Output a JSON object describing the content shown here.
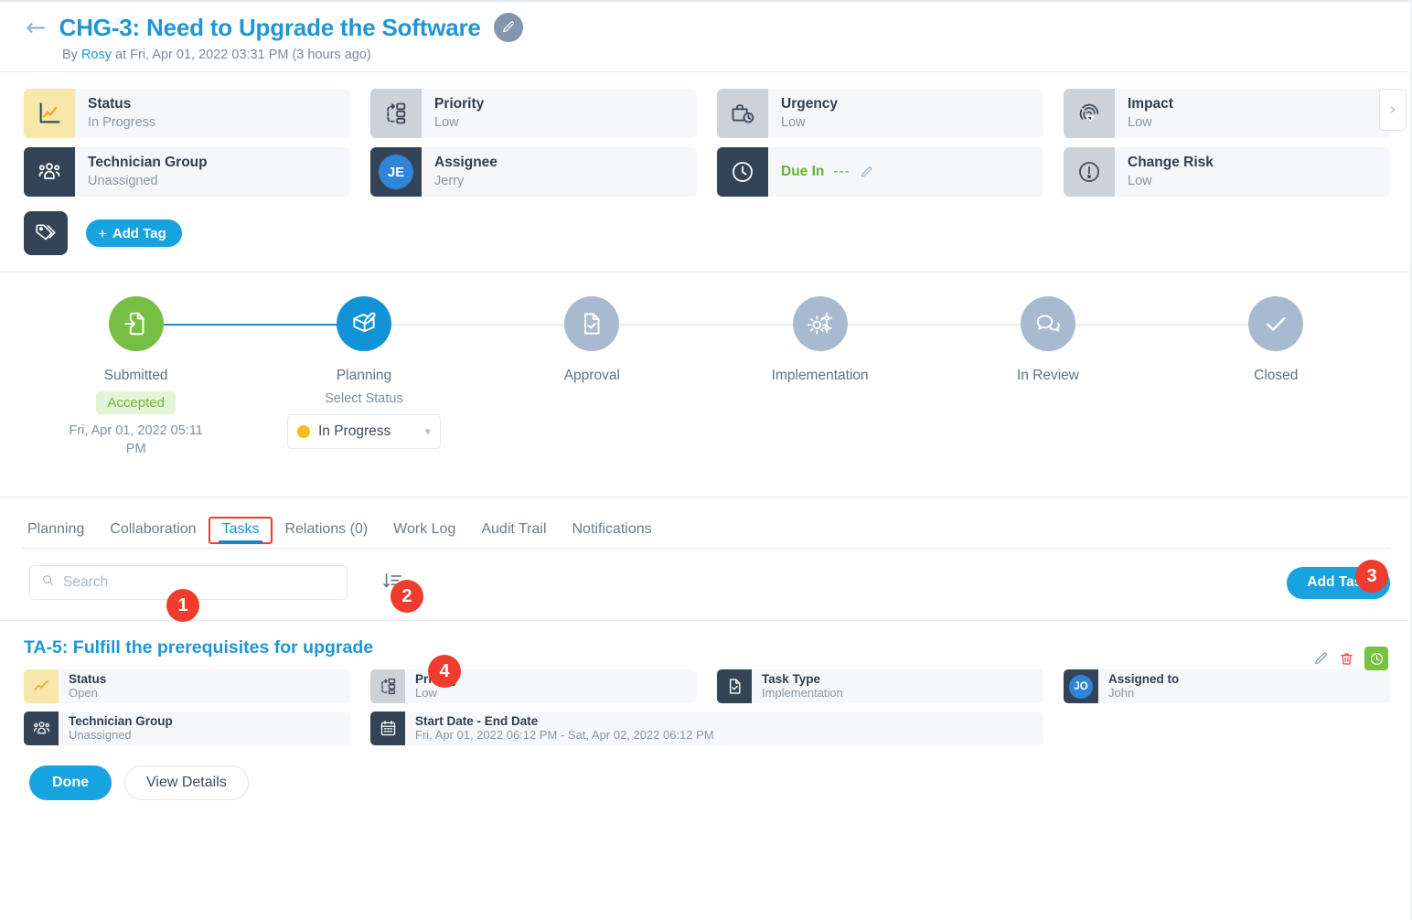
{
  "header": {
    "back_icon": "arrow-left-icon",
    "title": "CHG-3: Need to Upgrade the Software",
    "edit_icon": "pencil-icon",
    "byline_prefix": "By ",
    "byline_author": "Rosy",
    "byline_suffix": " at Fri, Apr 01, 2022 03:31 PM (3 hours ago)"
  },
  "properties": [
    {
      "label": "Status",
      "value": "In Progress",
      "icon": "chart-line-icon",
      "icon_style": "yellow"
    },
    {
      "label": "Priority",
      "value": "Low",
      "icon": "priority-icon",
      "icon_style": "gray"
    },
    {
      "label": "Urgency",
      "value": "Low",
      "icon": "briefcase-clock-icon",
      "icon_style": "gray"
    },
    {
      "label": "Impact",
      "value": "Low",
      "icon": "fingerprint-icon",
      "icon_style": "gray"
    },
    {
      "label": "Technician Group",
      "value": "Unassigned",
      "icon": "people-group-icon",
      "icon_style": "dark"
    },
    {
      "label": "Assignee",
      "value": "Jerry",
      "icon": "avatar",
      "icon_style": "dark",
      "initials": "JE"
    },
    {
      "label": "Due In",
      "value": "---",
      "icon": "clock-icon",
      "icon_style": "dark",
      "kind": "duein",
      "edit_icon": "pencil-icon"
    },
    {
      "label": "Change Risk",
      "value": "Low",
      "icon": "alert-circle-icon",
      "icon_style": "gray"
    }
  ],
  "scroll_next_icon": "chevron-right-icon",
  "tags": {
    "icon": "tag-icon",
    "add_label": "Add Tag",
    "plus": "+"
  },
  "workflow": [
    {
      "name": "Submitted",
      "icon": "file-import-icon",
      "state": "green",
      "badge": "Accepted",
      "date": "Fri, Apr 01, 2022 05:11 PM",
      "line": "done"
    },
    {
      "name": "Planning",
      "icon": "edit-board-icon",
      "state": "blue",
      "sub_label": "Select Status",
      "select_value": "In Progress",
      "select_dot_color": "#f7bd1a",
      "line": "todo"
    },
    {
      "name": "Approval",
      "icon": "file-check-icon",
      "state": "gray",
      "line": "todo"
    },
    {
      "name": "Implementation",
      "icon": "gears-icon",
      "state": "gray",
      "line": "todo"
    },
    {
      "name": "In Review",
      "icon": "chat-bubbles-icon",
      "state": "gray",
      "line": "todo"
    },
    {
      "name": "Closed",
      "icon": "check-icon",
      "state": "gray",
      "line": "none"
    }
  ],
  "tabs": [
    {
      "label": "Planning",
      "active": false
    },
    {
      "label": "Collaboration",
      "active": false
    },
    {
      "label": "Tasks",
      "active": true
    },
    {
      "label": "Relations (0)",
      "active": false
    },
    {
      "label": "Work Log",
      "active": false
    },
    {
      "label": "Audit Trail",
      "active": false
    },
    {
      "label": "Notifications",
      "active": false
    }
  ],
  "toolbar": {
    "search_placeholder": "Search",
    "search_value": "",
    "search_icon": "search-icon",
    "sort_icon": "sort-descending-icon",
    "add_task_label": "Add Task"
  },
  "task": {
    "title": "TA-5: Fulfill the prerequisites for upgrade",
    "actions": [
      {
        "name": "edit-icon",
        "icon": "pencil-icon"
      },
      {
        "name": "delete-icon",
        "icon": "trash-icon"
      },
      {
        "name": "timer-button",
        "icon": "clock-icon"
      }
    ],
    "fields": [
      {
        "label": "Status",
        "value": "Open",
        "icon": "chart-line-icon",
        "icon_style": "yellow"
      },
      {
        "label": "Priority",
        "value": "Low",
        "icon": "priority-icon",
        "icon_style": "gray"
      },
      {
        "label": "Task Type",
        "value": "Implementation",
        "icon": "file-check-icon",
        "icon_style": "dark"
      },
      {
        "label": "Assigned to",
        "value": "John",
        "icon": "avatar",
        "icon_style": "dark",
        "initials": "JO"
      },
      {
        "label": "Technician Group",
        "value": "Unassigned",
        "icon": "people-group-icon",
        "icon_style": "dark"
      },
      {
        "label": "Start Date - End Date",
        "value": "Fri, Apr 01, 2022 06:12 PM - Sat, Apr 02, 2022 06:12 PM",
        "icon": "calendar-icon",
        "icon_style": "dark",
        "wide": true
      }
    ],
    "done_label": "Done",
    "view_details_label": "View Details"
  },
  "annotations": [
    {
      "number": "1",
      "target": "search-input"
    },
    {
      "number": "2",
      "target": "sort-button"
    },
    {
      "number": "3",
      "target": "add-task-button"
    },
    {
      "number": "4",
      "target": "task-title"
    }
  ],
  "colors": {
    "accent": "#17a3e0",
    "link": "#2196d6",
    "green": "#77bf44",
    "amber": "#f7bd1a",
    "annotation_red": "#f03c2e",
    "dark_icon_bg": "#344456"
  }
}
